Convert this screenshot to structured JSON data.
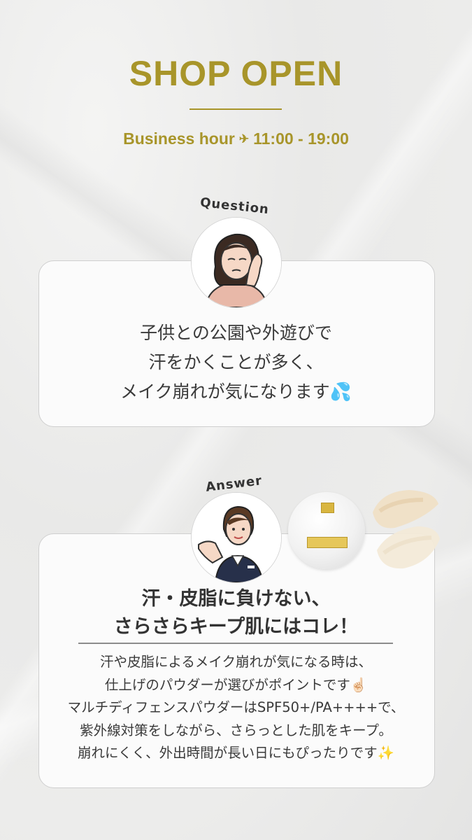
{
  "header": {
    "title": "SHOP OPEN",
    "hours_label": "Business hour",
    "hours_icon": "airplane-icon",
    "hours_value": "11:00 - 19:00",
    "accent_color": "#a8952a"
  },
  "question": {
    "label": "Question",
    "avatar_icon": "worried-woman-icon",
    "lines": [
      "子供との公園や外遊びで",
      "汗をかくことが多く、",
      "メイク崩れが気になります💦"
    ]
  },
  "answer": {
    "label": "Answer",
    "avatar_icon": "staff-woman-icon",
    "product_icon": "powder-compact-icon",
    "swatch_icon": "powder-swatch-icon",
    "headline": [
      "汗・皮脂に負けない、",
      "さらさらキープ肌にはコレ！"
    ],
    "body": [
      "汗や皮脂によるメイク崩れが気になる時は、",
      "仕上げのパウダーが選びがポイントです☝🏻",
      "マルチディフェンスパウダーはSPF50+/PA++++で、",
      "紫外線対策をしながら、さらっとした肌をキープ。",
      "崩れにくく、外出時間が長い日にもぴったりです✨"
    ]
  }
}
